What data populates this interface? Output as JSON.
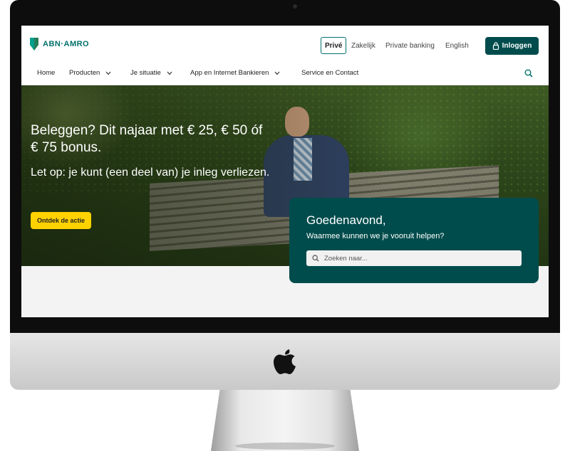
{
  "brand": {
    "logo_text": "ABN·AMRO",
    "accent": "#00716b",
    "dark": "#004c4c",
    "cta_color": "#ffd200"
  },
  "segments": [
    {
      "label": "Privé",
      "active": true
    },
    {
      "label": "Zakelijk"
    },
    {
      "label": "Private banking"
    },
    {
      "label": "English"
    }
  ],
  "login": {
    "label": "Inloggen",
    "icon": "lock-icon"
  },
  "nav": {
    "items": [
      {
        "label": "Home"
      },
      {
        "label": "Producten",
        "dropdown": true
      },
      {
        "label": "Je situatie",
        "dropdown": true
      },
      {
        "label": "App en Internet Bankieren",
        "dropdown": true
      },
      {
        "label": "Service en Contact"
      }
    ],
    "search_icon": "search-icon"
  },
  "hero": {
    "title": "Beleggen? Dit najaar met € 25, € 50 óf € 75 bonus.",
    "subtitle": "Let op: je kunt (een deel van) je inleg verliezen.",
    "cta": "Ontdek de actie"
  },
  "greeting": {
    "title": "Goedenavond,",
    "subtitle": "Waarmee kunnen we je vooruit helpen?",
    "search_placeholder": "Zoeken naar..."
  },
  "device": {
    "logo": "apple-logo-icon"
  }
}
